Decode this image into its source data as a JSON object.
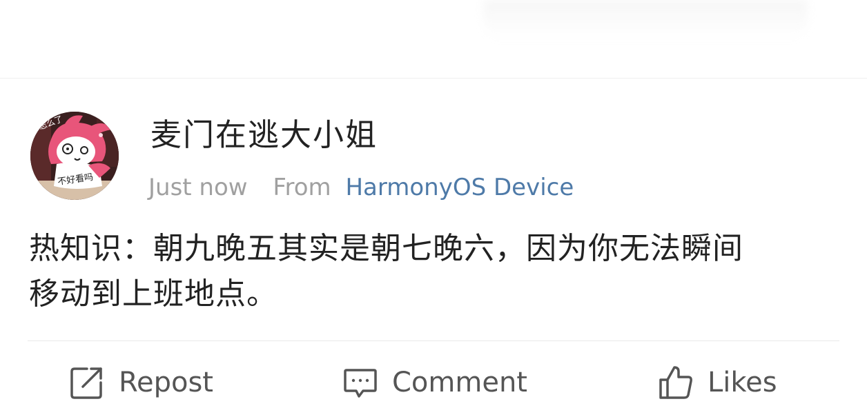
{
  "post": {
    "username": "麦门在逃大小姐",
    "time": "Just now",
    "from_label": "From",
    "device": "HarmonyOS Device",
    "content_line1": "热知识：朝九晚五其实是朝七晚六，因为你无法瞬间",
    "content_line2": "移动到上班地点。",
    "avatar_text_top": "怎么了",
    "avatar_text_bottom": "不好看吗"
  },
  "actions": {
    "repost_label": "Repost",
    "comment_label": "Comment",
    "likes_label": "Likes"
  },
  "icons": {
    "repost": "repost-icon",
    "comment": "comment-icon",
    "likes": "thumbs-up-icon"
  },
  "colors": {
    "link": "#4e7aa8",
    "muted": "#a0a0a0",
    "text": "#222222",
    "icon": "#555555"
  }
}
